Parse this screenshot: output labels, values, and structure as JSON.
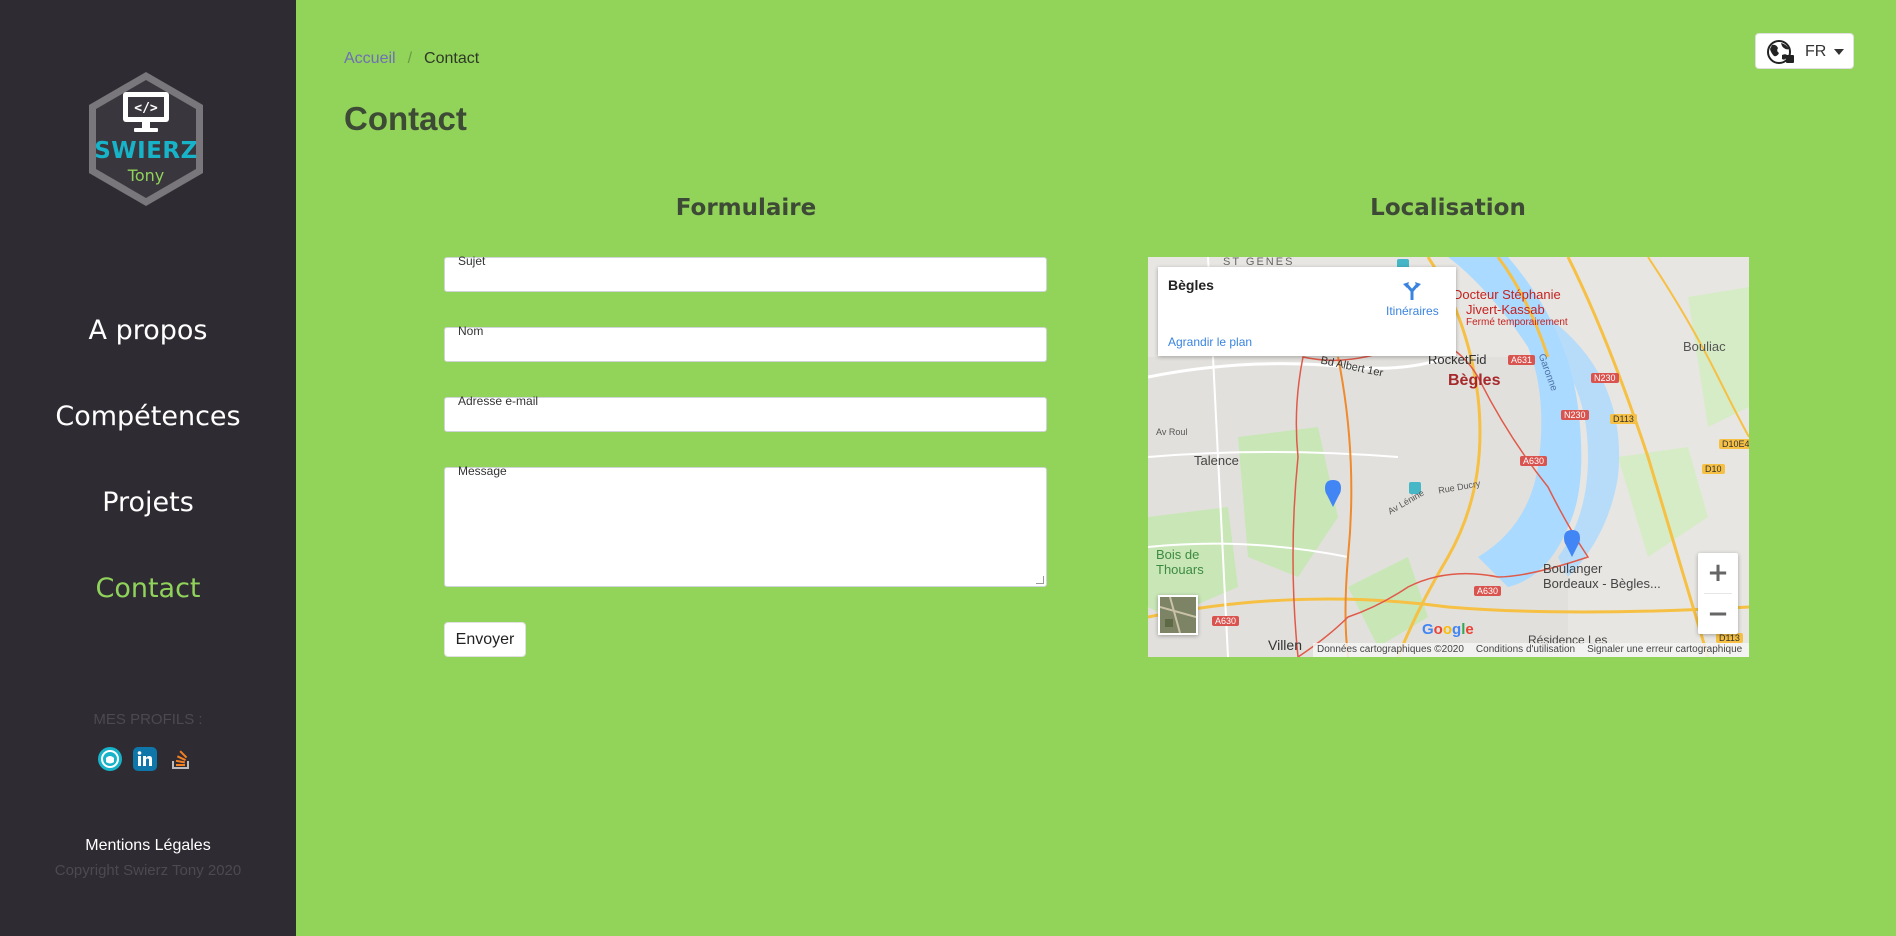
{
  "sidebar": {
    "logo": {
      "brand": "SWIERZ",
      "sub": "Tony"
    },
    "nav": [
      {
        "label": "A propos"
      },
      {
        "label": "Compétences"
      },
      {
        "label": "Projets"
      },
      {
        "label": "Contact"
      }
    ],
    "profiles_label": "MES PROFILS :",
    "social_icons": [
      "github-icon",
      "linkedin-icon",
      "stackoverflow-icon"
    ],
    "legal": "Mentions Légales",
    "copyright": "Copyright Swierz Tony 2020"
  },
  "breadcrumb": {
    "home": "Accueil",
    "separator": "/",
    "current": "Contact"
  },
  "page_title": "Contact",
  "language": {
    "code": "FR",
    "icon": "globe-icon"
  },
  "form": {
    "title": "Formulaire",
    "fields": {
      "subject": "Sujet",
      "name": "Nom",
      "email": "Adresse e-mail",
      "message": "Message"
    },
    "submit": "Envoyer"
  },
  "map": {
    "title": "Localisation",
    "place": "Bègles",
    "directions": "Itinéraires",
    "enlarge": "Agrandir le plan",
    "zoom_in": "+",
    "zoom_out": "−",
    "google": "Google",
    "attribution": [
      "Données cartographiques ©2020",
      "Conditions d'utilisation",
      "Signaler une erreur cartographique"
    ],
    "labels": {
      "st_genes": "ST GENES",
      "docteur_1": "Docteur Stéphanie",
      "docteur_2": "Jivert-Kassab",
      "docteur_3": "Fermé temporairement",
      "rocketfid": "RocketFid",
      "bd_albert": "Bd Albert 1er",
      "begles": "Bègles",
      "bouliac": "Bouliac",
      "talence": "Talence",
      "bois_1": "Bois de",
      "bois_2": "Thouars",
      "boulanger_1": "Boulanger",
      "boulanger_2": "Bordeaux - Bègles...",
      "villen": "Villen",
      "residence": "Résidence Les",
      "garonne": "Garonne",
      "rue_ducry": "Rue Ducry",
      "av_leningrad": "Av Lénine",
      "av_roul": "Av Roul",
      "road_a631": "A631",
      "road_n230a": "N230",
      "road_n230b": "N230",
      "road_d113": "D113",
      "road_d10e4": "D10E4",
      "road_a630a": "A630",
      "road_d10": "D10",
      "road_a630b": "A630",
      "road_a630c": "A630",
      "road_d113b": "D113",
      "es": "es"
    },
    "colors": {
      "boundary": "#e05a4a",
      "water": "#aadaff",
      "road_major": "#f6c044",
      "park": "#c8e6b6"
    }
  },
  "colors": {
    "background": "#92d359",
    "sidebar": "#2f2b32",
    "accent": "#8fd35a",
    "brand": "#17b3c9"
  }
}
